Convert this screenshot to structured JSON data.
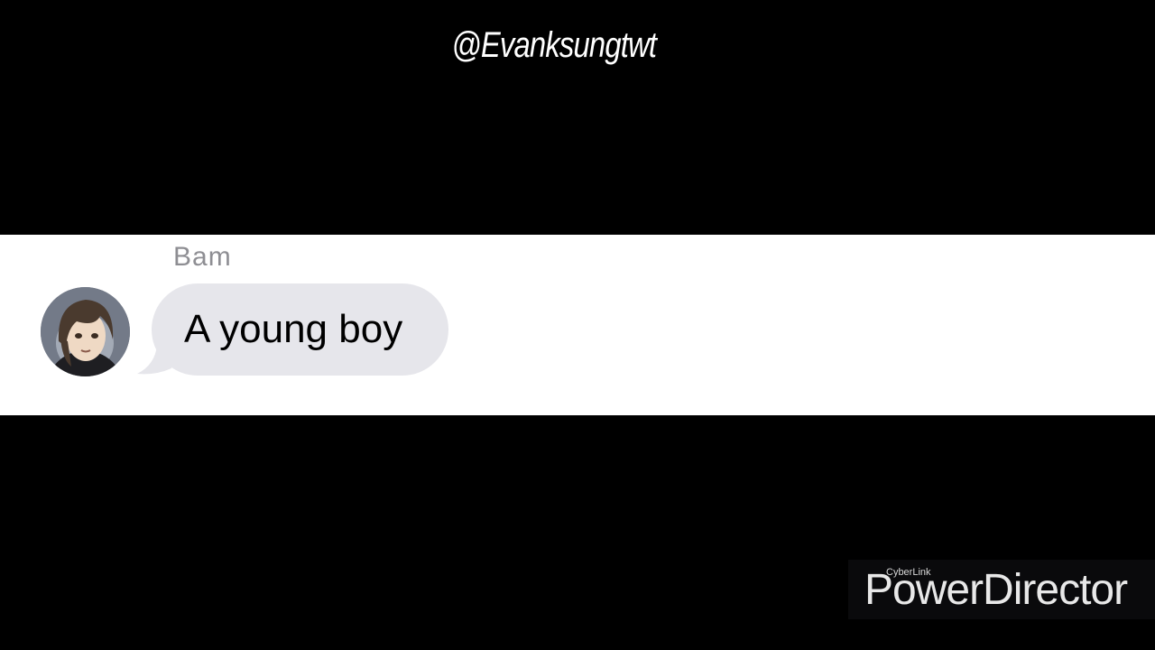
{
  "watermark": {
    "handle": "@Evanksungtwt"
  },
  "message": {
    "sender": "Bam",
    "text": "A young boy",
    "bubble_color": "#e6e6eb",
    "name_color": "#8e8e93"
  },
  "branding": {
    "maker": "CyberLink",
    "product": "PowerDirector"
  },
  "colors": {
    "background": "#000000",
    "strip": "#ffffff"
  }
}
